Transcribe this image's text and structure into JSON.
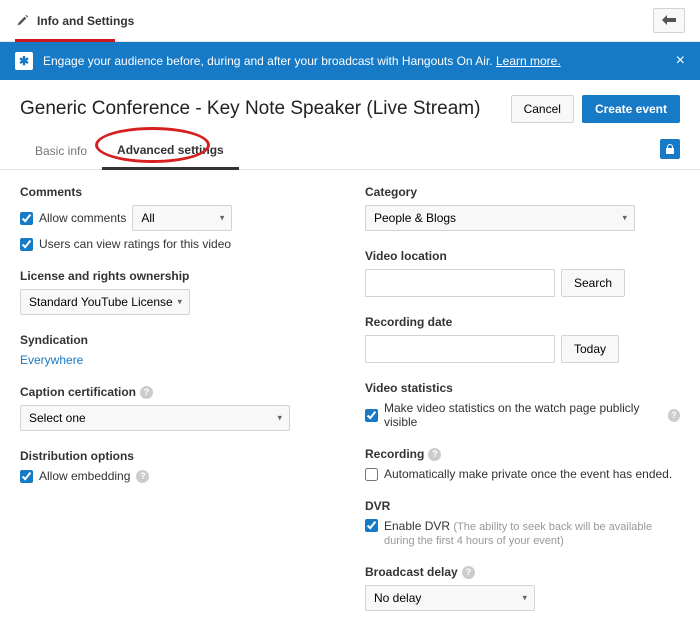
{
  "topbar": {
    "title": "Info and Settings"
  },
  "banner": {
    "text": "Engage your audience before, during and after your broadcast with Hangouts On Air.",
    "link": "Learn more."
  },
  "header": {
    "title": "Generic Conference - Key Note Speaker (Live Stream)",
    "cancel": "Cancel",
    "create": "Create event"
  },
  "tabs": {
    "basic": "Basic info",
    "advanced": "Advanced settings"
  },
  "left": {
    "comments": {
      "title": "Comments",
      "allow": "Allow comments",
      "filter": "All",
      "ratings": "Users can view ratings for this video"
    },
    "license": {
      "title": "License and rights ownership",
      "value": "Standard YouTube License"
    },
    "syndication": {
      "title": "Syndication",
      "value": "Everywhere"
    },
    "caption": {
      "title": "Caption certification",
      "value": "Select one"
    },
    "dist": {
      "title": "Distribution options",
      "embed": "Allow embedding"
    }
  },
  "right": {
    "category": {
      "title": "Category",
      "value": "People & Blogs"
    },
    "location": {
      "title": "Video location",
      "search": "Search"
    },
    "recdate": {
      "title": "Recording date",
      "today": "Today"
    },
    "stats": {
      "title": "Video statistics",
      "visible": "Make video statistics on the watch page publicly visible"
    },
    "recording": {
      "title": "Recording",
      "auto": "Automatically make private once the event has ended."
    },
    "dvr": {
      "title": "DVR",
      "enable": "Enable DVR",
      "hint": "(The ability to seek back will be available during the first 4 hours of your event)"
    },
    "delay": {
      "title": "Broadcast delay",
      "value": "No delay"
    }
  }
}
